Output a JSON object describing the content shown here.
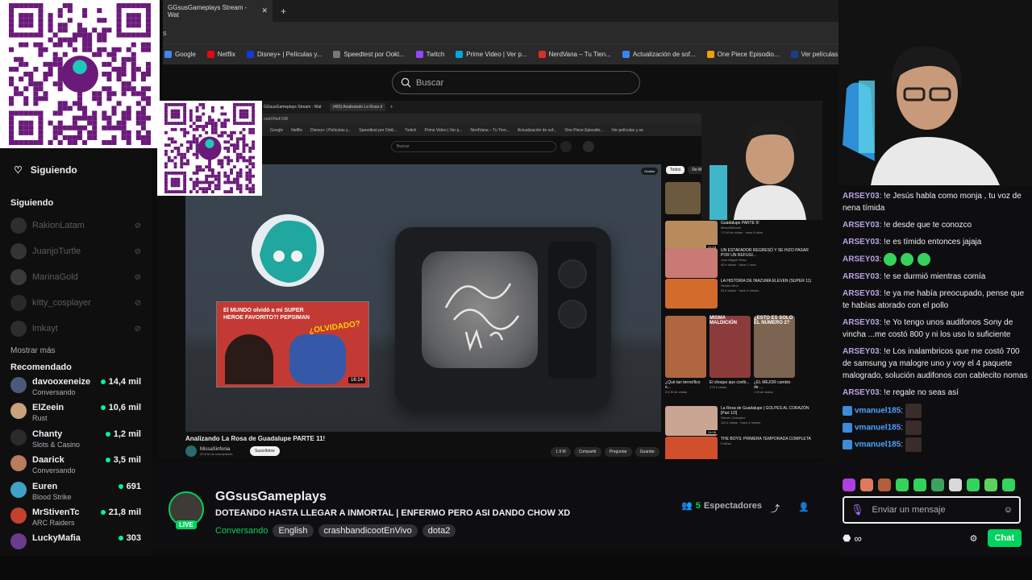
{
  "browser": {
    "tab_title": "GGsusGameplays Stream - Wat",
    "url_fragment": "s",
    "bookmarks": [
      "Google",
      "Netflix",
      "Disney+ | Películas y...",
      "Speedtest por Ookl...",
      "Twitch",
      "Prime Video | Ver p...",
      "NerdVana – Tu Tien...",
      "Actualización de sof...",
      "One Piece Episodio...",
      "Ver películas y se"
    ],
    "bookmark_colors": [
      "#4285f4",
      "#e50914",
      "#113ccf",
      "#777777",
      "#9146ff",
      "#00a8e1",
      "#d93025",
      "#3b82f6",
      "#f59e0b",
      "#1e3a8a"
    ],
    "search_placeholder": "Buscar"
  },
  "inner_browser": {
    "tabs": [
      "GGsusGameplays Stream - Wat",
      "(483) Analizando La Rosa d"
    ],
    "url": "oodXf4uF108",
    "bookmarks": [
      "Google",
      "Netflix",
      "Disney+ | Películas y...",
      "Speedtest por Ookl...",
      "Twitch",
      "Prime Video | Ver p...",
      "NerdVana – Tu Tien...",
      "Actualización de sof...",
      "One Piece Episodio...",
      "Ver películas y se"
    ],
    "search_placeholder": "Buscar"
  },
  "video": {
    "title": "Analizando La Rosa de Guadalupe PARTE 11!",
    "channel": "MissaSinfonia",
    "subs": "20.5 M de suscriptores",
    "subscribe": "Suscribirse",
    "hide": "Ocultar",
    "card_title": "El MUNDO olvidó a mi SUPER HEROE FAVORITO?! PEPSIMAN",
    "card_overlay": "¿OLVIDADO?",
    "card_duration": "16:14",
    "actions": [
      "1.9 M",
      "Compartir",
      "Preguntar",
      "Guardar"
    ]
  },
  "recommendations": {
    "chips": [
      "Todos",
      "De M"
    ],
    "items": [
      {
        "title": "Guadalupe PARTE 5!",
        "channel": "MissaSinforce",
        "meta": "7.0 M de vistas · hace 8 años",
        "dur": "21:23",
        "color": "#b88a5c"
      },
      {
        "title": "UN ESTAFADOR REGRESÓ Y SE HIZO PASAR POR UN REFUGI...",
        "channel": "Joss Miguel Rosa",
        "meta": "40 k vistas · hace 1 hora",
        "dur": "",
        "color": "#c97a74"
      },
      {
        "title": "LA HISTORIA DE INAZUMA ELEVEN (SUPER 11)",
        "channel": "Sesitro Nino",
        "meta": "24 k vistas · hace 6 meses",
        "dur": "",
        "color": "#d26b2c"
      },
      {
        "title": "La Rosa de Guadalupe | GOLPES AL CORAZÓN [Part 1/2]",
        "channel": "Steven Gonzalez",
        "meta": "113 k vistas · hace 4 meses",
        "dur": "24:08",
        "color": "#c9a593"
      },
      {
        "title": "THE BOYS: PRIMERA TEMPORADA COMPLETA",
        "channel": "FolDan",
        "meta": "",
        "dur": "",
        "color": "#d24f2c"
      }
    ],
    "shorts": [
      {
        "title": "¿Qué tan terrorífico e...",
        "views": "5.6 M de vistas",
        "color": "#b0673f",
        "label": ""
      },
      {
        "title": "El choque que confir...",
        "views": "379 k vistas",
        "color": "#8c3b3b",
        "label": "MISMA MALDICIÓN"
      },
      {
        "title": "¿EL MEJOR cambio de ...",
        "views": "1 M de vistas",
        "color": "#7b6450",
        "label": "¿ESTO ES SOLO EL NÚMERO 2?"
      }
    ]
  },
  "sidebar": {
    "following_header": "Siguiendo",
    "section_following": "Siguiendo",
    "offline": [
      {
        "name": "RakionLatam",
        "color": "#6b6b6b"
      },
      {
        "name": "JuanjoTurtle",
        "color": "#7a7a7a"
      },
      {
        "name": "MarinaGold",
        "color": "#8c8c8c"
      },
      {
        "name": "kitty_cosplayer",
        "color": "#5d5d5d"
      },
      {
        "name": "lmkayt",
        "color": "#666666"
      }
    ],
    "show_more": "Mostrar más",
    "section_recommended": "Recomendado",
    "recommended": [
      {
        "name": "davooxeneize",
        "game": "Conversando",
        "viewers": "14,4 mil",
        "color": "#4c5a7a"
      },
      {
        "name": "ElZeein",
        "game": "Rust",
        "viewers": "10,6 mil",
        "color": "#c7a27a"
      },
      {
        "name": "Chanty",
        "game": "Slots & Casino",
        "viewers": "1,2 mil",
        "color": "#2b2b2b"
      },
      {
        "name": "Daarick",
        "game": "Conversando",
        "viewers": "3,5 mil",
        "color": "#b97c5c"
      },
      {
        "name": "Euren",
        "game": "Blood Strike",
        "viewers": "691",
        "color": "#3fa3c6"
      },
      {
        "name": "MrStivenTc",
        "game": "ARC Raiders",
        "viewers": "21,8 mil",
        "color": "#c2412f"
      },
      {
        "name": "LuckyMafia",
        "game": "",
        "viewers": "303",
        "color": "#6a3b8c"
      }
    ]
  },
  "stream": {
    "channel": "GGsusGameplays",
    "title": "DOTEANDO HASTA LLEGAR A INMORTAL | ENFERMO PERO ASI DANDO CHOW XD",
    "category": "Conversando",
    "tags": [
      "English",
      "crashbandicootEnVivo",
      "dota2"
    ],
    "viewers_count": "5",
    "viewers_label": "Espectadores",
    "live": "LIVE"
  },
  "chat": {
    "messages": [
      {
        "user": "ARSEY03",
        "text": "!e Jesús habla como monja , tu voz de nena tímida"
      },
      {
        "user": "ARSEY03",
        "text": "!e desde que te conozco"
      },
      {
        "user": "ARSEY03",
        "text": "!e es tímido entonces jajaja"
      },
      {
        "user": "ARSEY03",
        "text": ""
      },
      {
        "user": "ARSEY03",
        "text": "!e se durmió mientras comía"
      },
      {
        "user": "ARSEY03",
        "text": "!e ya me había preocupado, pense que te habías atorado con el pollo"
      },
      {
        "user": "ARSEY03",
        "text": "!e Yo tengo unos audifonos Sony de vincha ...me costó 800 y ni los uso lo suficiente"
      },
      {
        "user": "ARSEY03",
        "text": "!e Los inalambricos que me costó 700 de samsung ya malogre uno y voy el 4 paquete malogrado, solución audifonos con cablecito nomas"
      },
      {
        "user": "ARSEY03",
        "text": "!e regale no seas así"
      }
    ],
    "v_messages": [
      {
        "user": "vmanuel185"
      },
      {
        "user": "vmanuel185"
      },
      {
        "user": "vmanuel185"
      }
    ],
    "input_placeholder": "Enviar un mensaje",
    "send": "Chat"
  }
}
